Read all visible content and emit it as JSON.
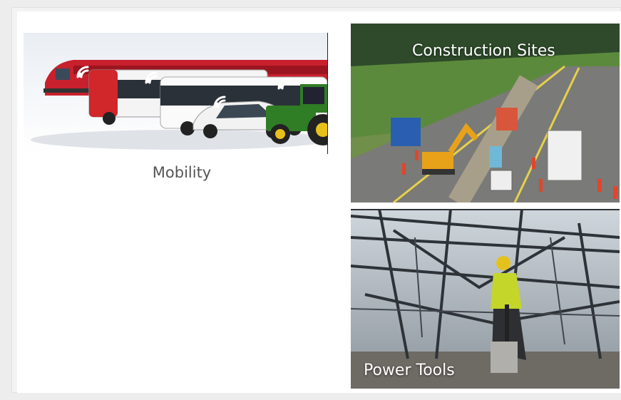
{
  "cards": {
    "mobility": {
      "label": "Mobility"
    },
    "construction": {
      "label": "Construction Sites"
    },
    "power_tools": {
      "label": "Power Tools"
    }
  },
  "colors": {
    "background": "#ededed",
    "panel": "#ffffff",
    "label_text": "#555555",
    "tile_title": "#ffffff"
  }
}
